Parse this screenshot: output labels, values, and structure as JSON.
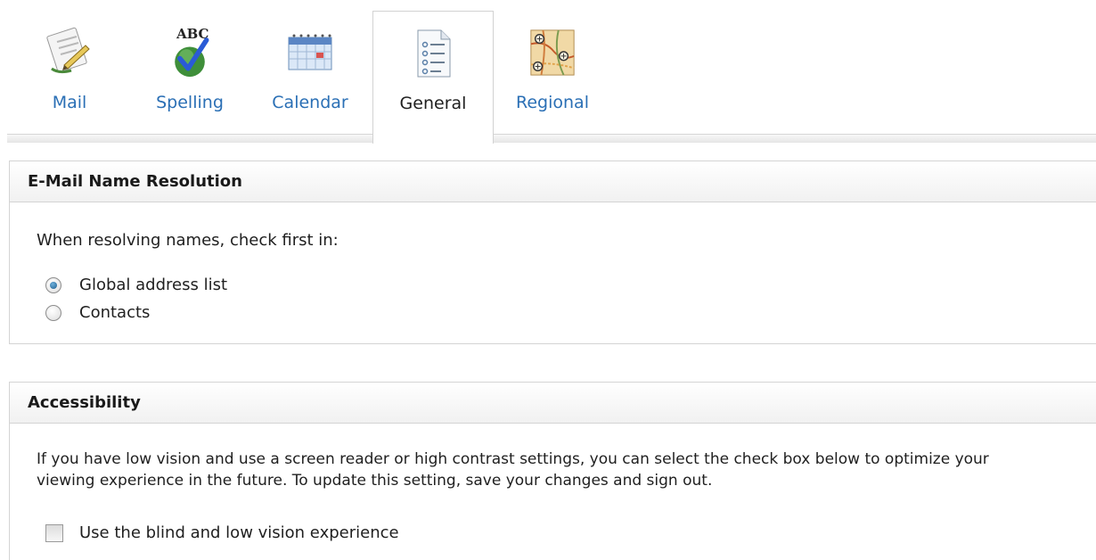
{
  "tabs": [
    {
      "label": "Mail",
      "icon": "mail-icon"
    },
    {
      "label": "Spelling",
      "icon": "spelling-icon"
    },
    {
      "label": "Calendar",
      "icon": "calendar-icon"
    },
    {
      "label": "General",
      "icon": "general-icon",
      "selected": true
    },
    {
      "label": "Regional",
      "icon": "regional-icon"
    }
  ],
  "email_resolution": {
    "title": "E-Mail Name Resolution",
    "prompt": "When resolving names, check first in:",
    "options": [
      {
        "label": "Global address list",
        "checked": true
      },
      {
        "label": "Contacts",
        "checked": false
      }
    ]
  },
  "accessibility": {
    "title": "Accessibility",
    "description": "If you have low vision and use a screen reader or high contrast settings, you can select the check box below to optimize your viewing experience in the future. To update this setting, save your changes and sign out.",
    "checkbox_label": "Use the blind and low vision experience",
    "checked": false
  },
  "colors": {
    "tab_link": "#2a6fb5",
    "radio_selected": "#1d5d8c",
    "border": "#d4d4d4"
  }
}
